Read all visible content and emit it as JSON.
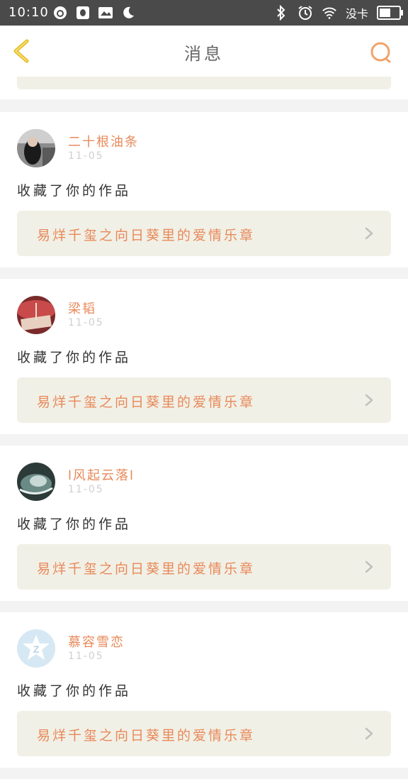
{
  "status_bar": {
    "time": "10:10",
    "carrier": "没卡",
    "battery_level": 0.7,
    "icons": [
      "netease-music-icon",
      "qq-icon",
      "message-icon",
      "moon-icon",
      "bluetooth-icon",
      "alarm-icon",
      "wifi-icon",
      "battery-icon"
    ]
  },
  "header": {
    "title": "消息",
    "back_icon": "chevron-left-icon",
    "search_icon": "search-icon"
  },
  "colors": {
    "accent": "#e8895a",
    "back": "#f2c94c",
    "work_bg": "#f1f0e6"
  },
  "messages": [
    {
      "user": "二十根油条",
      "date": "11-05",
      "action": "收藏了你的作品",
      "work": "易烊千玺之向日葵里的爱情乐章",
      "avatar": "avatar-photo-dark"
    },
    {
      "user": "梁韬",
      "date": "11-05",
      "action": "收藏了你的作品",
      "work": "易烊千玺之向日葵里的爱情乐章",
      "avatar": "avatar-photo-red"
    },
    {
      "user": "l风起云落l",
      "date": "11-05",
      "action": "收藏了你的作品",
      "work": "易烊千玺之向日葵里的爱情乐章",
      "avatar": "avatar-photo-teal"
    },
    {
      "user": "慕容雪恋",
      "date": "11-05",
      "action": "收藏了你的作品",
      "work": "易烊千玺之向日葵里的爱情乐章",
      "avatar": "avatar-default-qq"
    }
  ]
}
